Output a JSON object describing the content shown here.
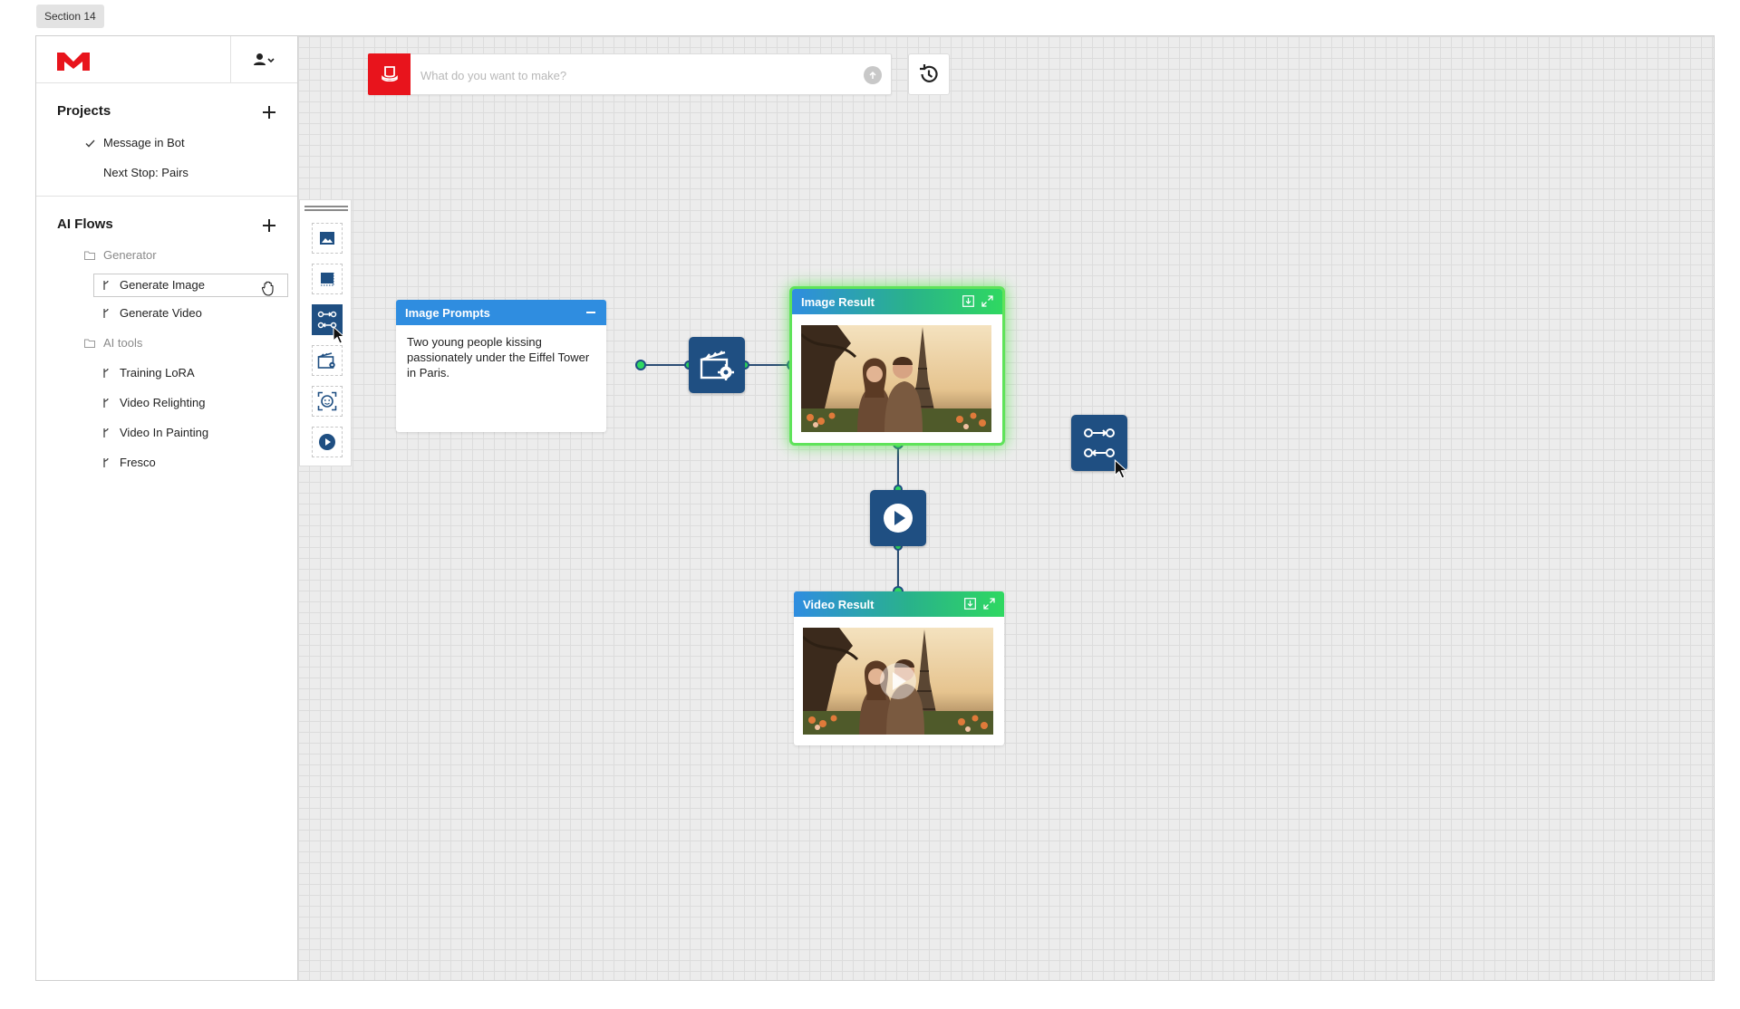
{
  "section_tag": "Section 14",
  "colors": {
    "brand_red": "#e8141c",
    "node_blue": "#1f4f82",
    "header_blue": "#2f8de0",
    "connector_green": "#2fd861"
  },
  "header": {
    "logo_icon": "m-logo-icon",
    "user_icon": "user-dropdown-icon"
  },
  "projects": {
    "title": "Projects",
    "items": [
      {
        "label": "Message in Bot",
        "checked": true
      },
      {
        "label": "Next Stop: Pairs",
        "checked": false
      }
    ]
  },
  "ai_flows": {
    "title": "AI Flows",
    "groups": [
      {
        "label": "Generator",
        "items": [
          "Generate Image",
          "Generate Video"
        ]
      },
      {
        "label": "AI tools",
        "items": [
          "Training LoRA",
          "Video Relighting",
          "Video In Painting",
          "Fresco"
        ]
      }
    ],
    "selected": "Generate Image"
  },
  "prompt_bar": {
    "placeholder": "What do you want to make?",
    "value": ""
  },
  "palette": {
    "tools": [
      "image-tool-icon",
      "crop-tool-icon",
      "flow-tool-icon",
      "video-settings-tool-icon",
      "face-tool-icon",
      "play-tool-icon"
    ],
    "active": "flow-tool-icon"
  },
  "nodes": {
    "image_prompts": {
      "title": "Image Prompts",
      "text": "Two young people kissing passionately under the Eiffel Tower in Paris."
    },
    "image_result": {
      "title": "Image Result"
    },
    "video_result": {
      "title": "Video Result"
    }
  }
}
